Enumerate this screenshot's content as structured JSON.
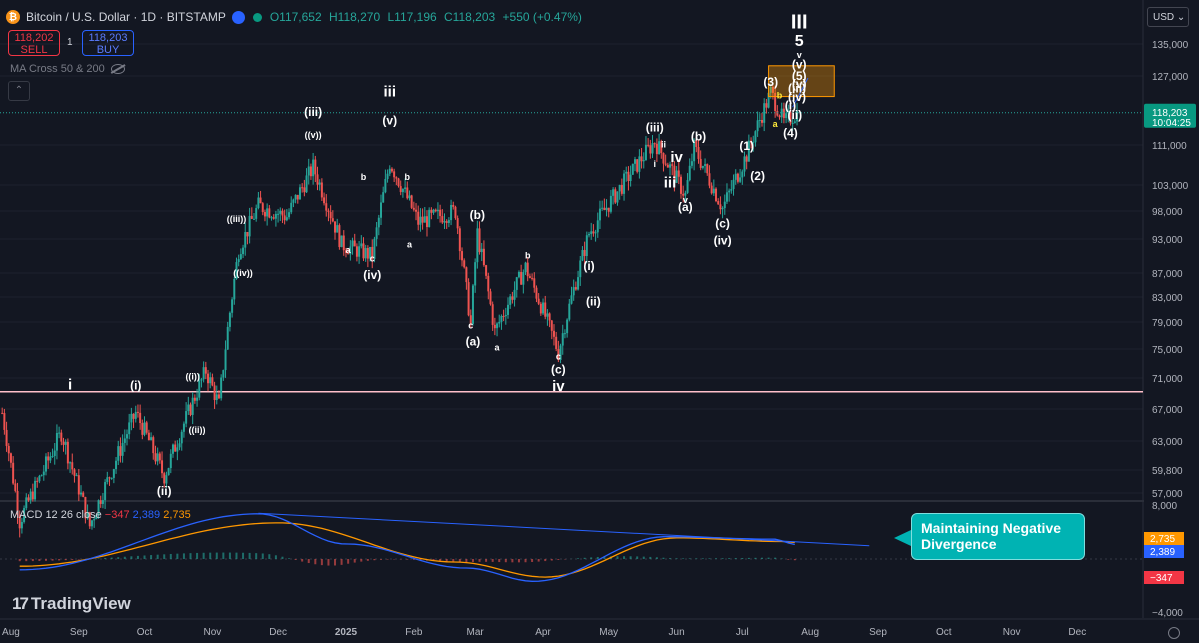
{
  "header": {
    "title": "Bitcoin / U.S. Dollar · 1D · BITSTAMP",
    "coin_glyph": "₿",
    "open": "O117,652",
    "high": "H118,270",
    "low": "L117,196",
    "close": "C118,203",
    "change": "+550 (+0.47%)"
  },
  "trade": {
    "sell_price": "118,202",
    "sell_label": "SELL",
    "spread": "1",
    "buy_price": "118,203",
    "buy_label": "BUY"
  },
  "indicator": {
    "ma_label": "MA Cross 50 & 200",
    "collapse_glyph": "⌃"
  },
  "currency": "USD ⌄",
  "macd": {
    "name": "MACD 12 26 close",
    "hist": "−347",
    "macd": "2,389",
    "signal": "2,735"
  },
  "callout": "Maintaining Negative Divergence",
  "brand": "TradingView",
  "price_axis": {
    "ticks": [
      "135,000",
      "127,000",
      "118,203",
      "111,000",
      "103,000",
      "98,000",
      "93,000",
      "87,000",
      "83,000",
      "79,000",
      "75,000",
      "71,000",
      "67,000",
      "63,000",
      "59,800",
      "57,000"
    ],
    "last_price": "118,203",
    "countdown": "10:04:25",
    "macd_ticks": [
      "8,000",
      "−4,000"
    ],
    "macd_badges": [
      "2,735",
      "2,389",
      "−347"
    ]
  },
  "time_axis": [
    "Aug",
    "Sep",
    "Oct",
    "Nov",
    "Dec",
    "2025",
    "Feb",
    "Mar",
    "Apr",
    "May",
    "Jun",
    "Jul",
    "Aug",
    "Sep",
    "Oct",
    "Nov",
    "Dec"
  ],
  "colors": {
    "up": "#26a69a",
    "down": "#ef5350",
    "macd": "#2962ff",
    "signal": "#ff9800",
    "support": "#ffc0cb",
    "box": "#ff9800"
  },
  "chart_data": {
    "type": "candlestick",
    "title": "Bitcoin / U.S. Dollar · 1D · BITSTAMP",
    "ylim": [
      55000,
      142000
    ],
    "support_level": 69200,
    "target_zone": [
      122000,
      129500
    ],
    "x": [
      "2024-08",
      "2024-09",
      "2024-10",
      "2024-11",
      "2024-12",
      "2025-01",
      "2025-02",
      "2025-03",
      "2025-04",
      "2025-05",
      "2025-06",
      "2025-07"
    ],
    "path_points": [
      [
        "2024-07-28",
        66500
      ],
      [
        "2024-08-05",
        54000
      ],
      [
        "2024-08-24",
        64000
      ],
      [
        "2024-09-06",
        53500
      ],
      [
        "2024-09-27",
        66500
      ],
      [
        "2024-10-10",
        59000
      ],
      [
        "2024-10-29",
        72000
      ],
      [
        "2024-11-04",
        67500
      ],
      [
        "2024-11-13",
        91000
      ],
      [
        "2024-11-22",
        99000
      ],
      [
        "2024-12-05",
        97000
      ],
      [
        "2024-12-17",
        106500
      ],
      [
        "2024-12-30",
        92000
      ],
      [
        "2025-01-13",
        90000
      ],
      [
        "2025-01-21",
        107500
      ],
      [
        "2025-02-03",
        96000
      ],
      [
        "2025-02-20",
        98000
      ],
      [
        "2025-02-27",
        78500
      ],
      [
        "2025-03-02",
        94000
      ],
      [
        "2025-03-10",
        77500
      ],
      [
        "2025-03-24",
        88000
      ],
      [
        "2025-04-08",
        74500
      ],
      [
        "2025-04-22",
        94000
      ],
      [
        "2025-05-22",
        111800
      ],
      [
        "2025-06-05",
        101000
      ],
      [
        "2025-06-09",
        110500
      ],
      [
        "2025-06-22",
        98500
      ],
      [
        "2025-07-03",
        109000
      ],
      [
        "2025-07-14",
        123000
      ],
      [
        "2025-07-20",
        116000
      ],
      [
        "2025-07-26",
        118203
      ]
    ],
    "macd": [
      [
        "2024-08-05",
        -1800
      ],
      [
        "2024-11-22",
        7500
      ],
      [
        "2025-01-01",
        2500
      ],
      [
        "2025-02-25",
        -1500
      ],
      [
        "2025-03-28",
        -3700
      ],
      [
        "2025-05-27",
        3700
      ],
      [
        "2025-07-15",
        3300
      ],
      [
        "2025-07-26",
        2389
      ]
    ],
    "signal": [
      [
        "2024-08-05",
        -1200
      ],
      [
        "2024-12-01",
        6000
      ],
      [
        "2025-02-20",
        -500
      ],
      [
        "2025-04-02",
        -3000
      ],
      [
        "2025-06-01",
        3500
      ],
      [
        "2025-07-20",
        2900
      ],
      [
        "2025-07-26",
        2735
      ]
    ],
    "wave_labels": [
      {
        "t": "i",
        "d": "2024-08-28",
        "p": 69500
      },
      {
        "t": "(i)",
        "d": "2024-09-27",
        "p": 69500
      },
      {
        "t": "(ii)",
        "d": "2024-10-10",
        "p": 56800
      },
      {
        "t": "((i))",
        "d": "2024-10-23",
        "p": 70800
      },
      {
        "t": "((ii))",
        "d": "2024-10-25",
        "p": 64000
      },
      {
        "t": "((iii))",
        "d": "2024-11-12",
        "p": 96000
      },
      {
        "t": "((iv))",
        "d": "2024-11-15",
        "p": 86500
      },
      {
        "t": "((v))",
        "d": "2024-12-17",
        "p": 112500
      },
      {
        "t": "(iii)",
        "d": "2024-12-17",
        "p": 117500
      },
      {
        "t": "a",
        "d": "2025-01-02",
        "p": 90500
      },
      {
        "t": "b",
        "d": "2025-01-09",
        "p": 104000
      },
      {
        "t": "c",
        "d": "2025-01-13",
        "p": 89000
      },
      {
        "t": "(iv)",
        "d": "2025-01-13",
        "p": 86000
      },
      {
        "t": "iii",
        "d": "2025-01-21",
        "p": 122000
      },
      {
        "t": "(v)",
        "d": "2025-01-21",
        "p": 115500
      },
      {
        "t": "b",
        "d": "2025-01-29",
        "p": 104000
      },
      {
        "t": "a",
        "d": "2025-01-30",
        "p": 91500
      },
      {
        "t": "(b)",
        "d": "2025-03-02",
        "p": 96500
      },
      {
        "t": "c",
        "d": "2025-02-27",
        "p": 78000
      },
      {
        "t": "(a)",
        "d": "2025-02-28",
        "p": 75500
      },
      {
        "t": "a",
        "d": "2025-03-11",
        "p": 74800
      },
      {
        "t": "b",
        "d": "2025-03-25",
        "p": 89500
      },
      {
        "t": "c",
        "d": "2025-04-08",
        "p": 73500
      },
      {
        "t": "(c)",
        "d": "2025-04-08",
        "p": 71600
      },
      {
        "t": "iv",
        "d": "2025-04-08",
        "p": 69300
      },
      {
        "t": "(i)",
        "d": "2025-04-22",
        "p": 87500
      },
      {
        "t": "(ii)",
        "d": "2025-04-24",
        "p": 81600
      },
      {
        "t": "(iii)",
        "d": "2025-05-22",
        "p": 114000
      },
      {
        "t": "ii",
        "d": "2025-05-26",
        "p": 110500
      },
      {
        "t": "i",
        "d": "2025-05-22",
        "p": 106500
      },
      {
        "t": "iii",
        "d": "2025-05-29",
        "p": 102500
      },
      {
        "t": "iv",
        "d": "2025-06-01",
        "p": 107500
      },
      {
        "t": "v",
        "d": "2025-06-05",
        "p": 99500
      },
      {
        "t": "(a)",
        "d": "2025-06-05",
        "p": 98000
      },
      {
        "t": "(b)",
        "d": "2025-06-11",
        "p": 112000
      },
      {
        "t": "(c)",
        "d": "2025-06-22",
        "p": 95000
      },
      {
        "t": "(iv)",
        "d": "2025-06-22",
        "p": 92000
      },
      {
        "t": "(1)",
        "d": "2025-07-03",
        "p": 110000
      },
      {
        "t": "(2)",
        "d": "2025-07-08",
        "p": 104000
      },
      {
        "t": "(3)",
        "d": "2025-07-14",
        "p": 124500
      },
      {
        "t": "b",
        "d": "2025-07-18",
        "p": 121500
      },
      {
        "t": "a",
        "d": "2025-07-16",
        "p": 115000
      },
      {
        "t": "(i)",
        "d": "2025-07-23",
        "p": 119000
      },
      {
        "t": "(ii)",
        "d": "2025-07-25",
        "p": 116800
      },
      {
        "t": "(iii)",
        "d": "2025-07-26",
        "p": 123000
      },
      {
        "t": "(iv)",
        "d": "2025-07-26",
        "p": 121000
      },
      {
        "t": "(4)",
        "d": "2025-07-23",
        "p": 112800
      },
      {
        "t": "(v)",
        "d": "2025-07-27",
        "p": 124000
      },
      {
        "t": "(5)",
        "d": "2025-07-27",
        "p": 126000
      },
      {
        "t": "(v)",
        "d": "2025-07-27",
        "p": 128800
      },
      {
        "t": "v",
        "d": "2025-07-27",
        "p": 131500
      },
      {
        "t": "5",
        "d": "2025-07-27",
        "p": 134500
      },
      {
        "t": "III",
        "d": "2025-07-27",
        "p": 139000
      }
    ]
  }
}
